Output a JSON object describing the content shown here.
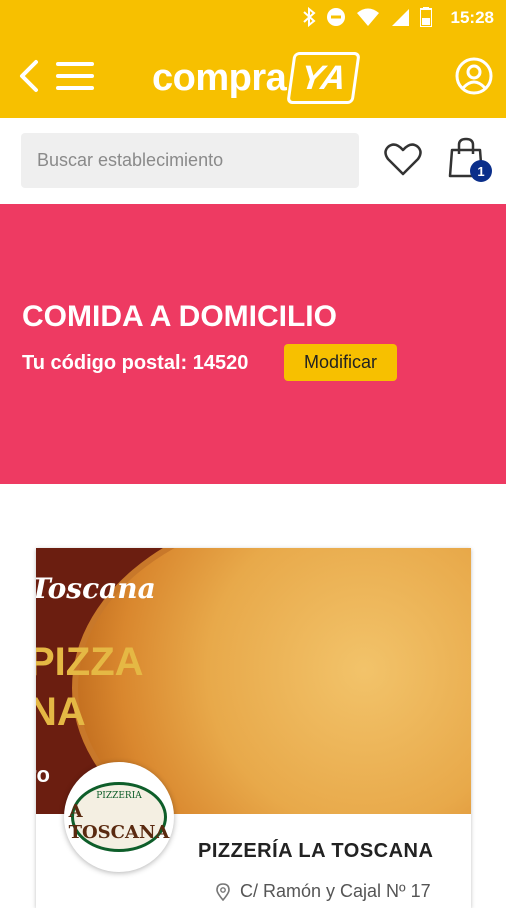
{
  "status": {
    "time": "15:28"
  },
  "appbar": {
    "logo_word": "compra",
    "logo_badge": "YA"
  },
  "search": {
    "placeholder": "Buscar establecimiento"
  },
  "cart": {
    "count": "1"
  },
  "hero": {
    "title": "COMIDA A DOMICILIO",
    "postal_label": "Tu código postal: 14520",
    "modify_label": "Modificar"
  },
  "store": {
    "banner_script": "Toscana",
    "banner_line1": "PIZZA",
    "banner_line2": "NA",
    "banner_line3": "ro",
    "logo_top": "PIZZERIA",
    "logo_main": "A TOSCANA",
    "name": "PIZZERÍA LA TOSCANA",
    "address": "C/ Ramón y Cajal Nº 17"
  },
  "colors": {
    "primary": "#F7C000",
    "hero": "#EE3A62",
    "badge": "#0A2E8A"
  },
  "icons": [
    "back-arrow-icon",
    "menu-icon",
    "account-icon",
    "heart-icon",
    "shopping-bag-icon",
    "location-pin-icon",
    "bluetooth-icon",
    "do-not-disturb-icon",
    "wifi-icon",
    "signal-icon",
    "battery-icon"
  ]
}
